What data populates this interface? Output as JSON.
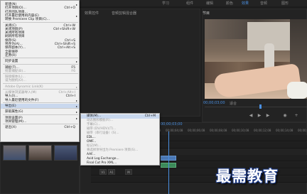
{
  "workspaces": [
    "学习",
    "组件",
    "编辑",
    "颜色",
    "效果",
    "音频",
    "图形"
  ],
  "active_workspace": "效果",
  "panels": {
    "source_tab": "效果控件",
    "audio_tab": "音频剪辑混合器",
    "program_tab": "节目",
    "program_timecode": "00;00;03;00",
    "fit_label": "适合",
    "timeline_timecode": "00;00;03;00"
  },
  "ruler_labels": [
    "00;00;02;08",
    "00;00;04;08",
    "00;00;06;08",
    "00;00;08;08",
    "00;00;10;08",
    "00;00;12;08",
    "00;00;14;08",
    "00;00;16;08"
  ],
  "menu": {
    "items": [
      {
        "label": "新建(N)",
        "shortcut": "",
        "arrow": true,
        "disabled": false
      },
      {
        "label": "打开项目(O)...",
        "shortcut": "Ctrl+O",
        "arrow": false,
        "disabled": false
      },
      {
        "label": "打开团队项目...",
        "shortcut": "",
        "arrow": false,
        "disabled": false
      },
      {
        "label": "打开最近使用的内容(E)",
        "shortcut": "",
        "arrow": true,
        "disabled": false
      },
      {
        "label": "转换 Premiere Clip 项目(C)...",
        "shortcut": "",
        "arrow": false,
        "disabled": false
      },
      {
        "sep": true
      },
      {
        "label": "关闭(C)",
        "shortcut": "Ctrl+W",
        "arrow": false,
        "disabled": false
      },
      {
        "label": "关闭项目(P)",
        "shortcut": "Ctrl+Shift+W",
        "arrow": false,
        "disabled": false
      },
      {
        "label": "关闭所有项目",
        "shortcut": "",
        "arrow": false,
        "disabled": false
      },
      {
        "label": "刷新所有项目",
        "shortcut": "",
        "arrow": false,
        "disabled": false
      },
      {
        "label": "保存(S)",
        "shortcut": "Ctrl+S",
        "arrow": false,
        "disabled": false
      },
      {
        "label": "另存为(A)...",
        "shortcut": "Ctrl+Shift+S",
        "arrow": false,
        "disabled": false
      },
      {
        "label": "保存副本(Y)...",
        "shortcut": "Ctrl+Alt+S",
        "arrow": false,
        "disabled": false
      },
      {
        "label": "全部保存",
        "shortcut": "",
        "arrow": false,
        "disabled": false
      },
      {
        "label": "还原(R)",
        "shortcut": "",
        "arrow": false,
        "disabled": false
      },
      {
        "sep": true
      },
      {
        "label": "同步设置",
        "shortcut": "",
        "arrow": true,
        "disabled": false
      },
      {
        "sep": true
      },
      {
        "label": "捕捉(T)...",
        "shortcut": "F5",
        "arrow": false,
        "disabled": false
      },
      {
        "label": "批量捕捉(B)...",
        "shortcut": "F6",
        "arrow": false,
        "disabled": true
      },
      {
        "sep": true
      },
      {
        "label": "链接媒体(L)...",
        "shortcut": "",
        "arrow": false,
        "disabled": true
      },
      {
        "label": "设为脱机(O)...",
        "shortcut": "",
        "arrow": false,
        "disabled": true
      },
      {
        "sep": true
      },
      {
        "label": "Adobe Dynamic Link(K)",
        "shortcut": "",
        "arrow": true,
        "disabled": true
      },
      {
        "sep": true
      },
      {
        "label": "从媒体浏览器导入(M)",
        "shortcut": "Ctrl+Alt+I",
        "arrow": false,
        "disabled": true
      },
      {
        "label": "导入(I)...",
        "shortcut": "Ctrl+I",
        "arrow": false,
        "disabled": false
      },
      {
        "label": "导入最近使用的文件(F)",
        "shortcut": "",
        "arrow": true,
        "disabled": false
      },
      {
        "sep": true
      },
      {
        "label": "导出(E)",
        "shortcut": "",
        "arrow": true,
        "disabled": false,
        "highlight": true
      },
      {
        "sep": true
      },
      {
        "label": "获取属性(G)",
        "shortcut": "",
        "arrow": true,
        "disabled": false
      },
      {
        "sep": true
      },
      {
        "label": "项目设置(P)",
        "shortcut": "",
        "arrow": true,
        "disabled": false
      },
      {
        "label": "项目管理(M)...",
        "shortcut": "",
        "arrow": false,
        "disabled": false
      },
      {
        "sep": true
      },
      {
        "label": "退出(X)",
        "shortcut": "Ctrl+Q",
        "arrow": false,
        "disabled": false
      }
    ]
  },
  "submenu": {
    "items": [
      {
        "label": "媒体(M)...",
        "shortcut": "Ctrl+M",
        "disabled": false,
        "highlight": true
      },
      {
        "label": "动态图形模板(R)...",
        "shortcut": "",
        "disabled": true
      },
      {
        "label": "字幕(C)...",
        "shortcut": "",
        "disabled": true
      },
      {
        "label": "磁带 (DV/HDV)(T)...",
        "shortcut": "",
        "disabled": true
      },
      {
        "label": "磁带（串行设备）(S)...",
        "shortcut": "",
        "disabled": true
      },
      {
        "label": "EDL...",
        "shortcut": "",
        "disabled": false
      },
      {
        "label": "OMF...",
        "shortcut": "",
        "disabled": false
      },
      {
        "label": "标记(M)...",
        "shortcut": "",
        "disabled": true
      },
      {
        "label": "将选择项导出为 Premiere 项目(S)...",
        "shortcut": "",
        "disabled": true
      },
      {
        "label": "AAF...",
        "shortcut": "",
        "disabled": false
      },
      {
        "label": "Avid Log Exchange...",
        "shortcut": "",
        "disabled": false
      },
      {
        "label": "Final Cut Pro XML...",
        "shortcut": "",
        "disabled": false
      }
    ]
  },
  "watermark": "最需教育"
}
